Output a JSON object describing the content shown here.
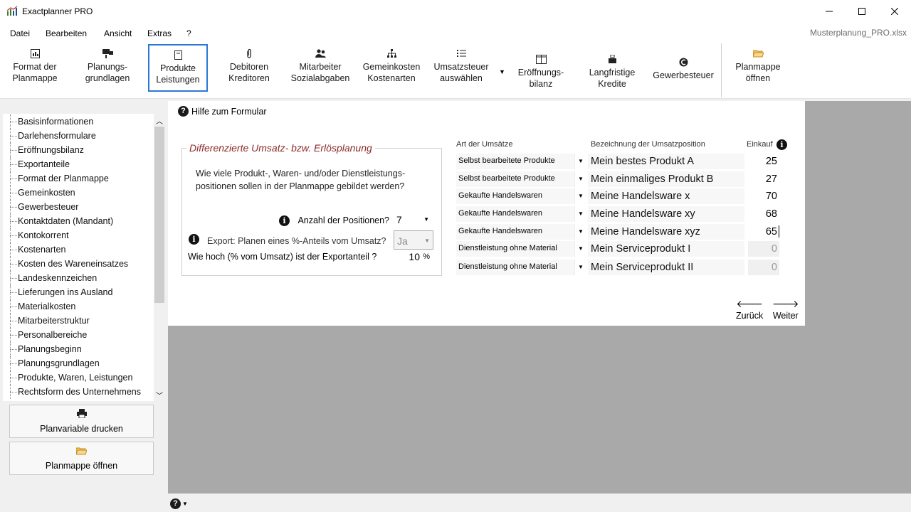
{
  "window": {
    "title": "Exactplanner PRO",
    "file_name": "Musterplanung_PRO.xlsx"
  },
  "menu": {
    "items": [
      "Datei",
      "Bearbeiten",
      "Ansicht",
      "Extras",
      "?"
    ]
  },
  "ribbon": {
    "buttons": [
      {
        "label": "Format der\nPlanmappe",
        "icon": "format-icon"
      },
      {
        "label": "Planungs-\ngrundlagen",
        "icon": "planning-icon"
      },
      {
        "label": "Produkte\nLeistungen",
        "icon": "products-icon",
        "active": true
      },
      {
        "label": "Debitoren\nKreditoren",
        "icon": "paperclip-icon"
      },
      {
        "label": "Mitarbeiter\nSozialabgaben",
        "icon": "employees-icon"
      },
      {
        "label": "Gemeinkosten\nKostenarten",
        "icon": "hierarchy-icon"
      },
      {
        "label": "Umsatzsteuer\nauswählen",
        "icon": "list-icon"
      },
      {
        "label": "Eröffnungs-\nbilanz",
        "icon": "balance-icon"
      },
      {
        "label": "Langfristige\nKredite",
        "icon": "loan-icon"
      },
      {
        "label": "Gewerbesteuer",
        "icon": "tax-icon"
      },
      {
        "label": "Planmappe\nöffnen",
        "icon": "folder-icon"
      }
    ]
  },
  "sidebar": {
    "items": [
      "Basisinformationen",
      "Darlehensformulare",
      "Eröffnungsbilanz",
      "Exportanteile",
      "Format der Planmappe",
      "Gemeinkosten",
      "Gewerbesteuer",
      "Kontaktdaten (Mandant)",
      "Kontokorrent",
      "Kostenarten",
      "Kosten des Wareneinsatzes",
      "Landeskennzeichen",
      "Lieferungen ins Ausland",
      "Materialkosten",
      "Mitarbeiterstruktur",
      "Personalbereiche",
      "Planungsbeginn",
      "Planungsgrundlagen",
      "Produkte, Waren, Leistungen",
      "Rechtsform des Unternehmens"
    ],
    "print_button": "Planvariable drucken",
    "open_button": "Planmappe öffnen"
  },
  "form": {
    "help_link": "Hilfe zum Formular",
    "group_title": "Differenzierte Umsatz- bzw. Erlösplanung",
    "question": "Wie viele Produkt-, Waren- und/oder Dienstleistungs-positionen sollen in der Planmappe gebildet werden?",
    "positions_label": "Anzahl der Positionen?",
    "positions_value": "7",
    "export_label": "Export: Planen eines %-Anteils vom Umsatz?",
    "export_value": "Ja",
    "share_label": "Wie hoch (% vom Umsatz) ist der Exportanteil ?",
    "share_value": "10",
    "share_unit": "%",
    "columns": {
      "type": "Art der Umsätze",
      "name": "Bezeichnung der Umsatzposition",
      "buy": "Einkauf"
    },
    "rows": [
      {
        "type": "Selbst bearbeitete Produkte",
        "name": "Mein bestes Produkt A",
        "buy": "25",
        "disabled": false
      },
      {
        "type": "Selbst bearbeitete Produkte",
        "name": "Mein einmaliges Produkt B",
        "buy": "27",
        "disabled": false
      },
      {
        "type": "Gekaufte Handelswaren",
        "name": "Meine Handelsware x",
        "buy": "70",
        "disabled": false
      },
      {
        "type": "Gekaufte Handelswaren",
        "name": "Meine Handelsware xy",
        "buy": "68",
        "disabled": false
      },
      {
        "type": "Gekaufte Handelswaren",
        "name": "Meine Handelsware xyz",
        "buy": "65",
        "disabled": false
      },
      {
        "type": "Dienstleistung ohne Material",
        "name": "Mein Serviceprodukt I",
        "buy": "0",
        "disabled": true
      },
      {
        "type": "Dienstleistung ohne Material",
        "name": "Mein Serviceprodukt II",
        "buy": "0",
        "disabled": true
      }
    ],
    "back_label": "Zurück",
    "next_label": "Weiter"
  },
  "colors": {
    "accent": "#2a7ad5",
    "group_title": "#8b2a2a",
    "workspace": "#a9a9a9"
  }
}
